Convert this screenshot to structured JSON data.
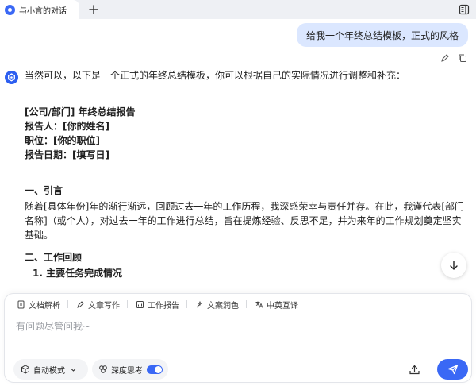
{
  "tab": {
    "title": "与小言的对话"
  },
  "user_message": "给我一个年终总结模板，正式的风格",
  "answer": {
    "intro": "当然可以，以下是一个正式的年终总结模板，你可以根据自己的实际情况进行调整和补充：",
    "header_lines": [
      "[公司/部门] 年终总结报告",
      "报告人：[你的姓名]",
      "职位：[你的职位]",
      "报告日期：[填写日]"
    ],
    "section1_title": "一、引言",
    "section1_body": "随着[具体年份]年的渐行渐远，回顾过去一年的工作历程，我深感荣幸与责任并存。在此，我谨代表[部门名称]（或个人），对过去一年的工作进行总结，旨在提炼经验、反思不足，并为来年的工作规划奠定坚实基础。",
    "section2_title": "二、工作回顾",
    "list_item_1": "1. 主要任务完成情况"
  },
  "composer": {
    "tools": [
      "文档解析",
      "文章写作",
      "工作报告",
      "文案润色",
      "中英互译"
    ],
    "placeholder": "有问题尽管问我~",
    "mode_label": "自动模式",
    "think_label": "深度思考",
    "think_enabled": true
  },
  "colors": {
    "accent": "#3a68f5",
    "user_bubble": "#dbe7ff"
  }
}
